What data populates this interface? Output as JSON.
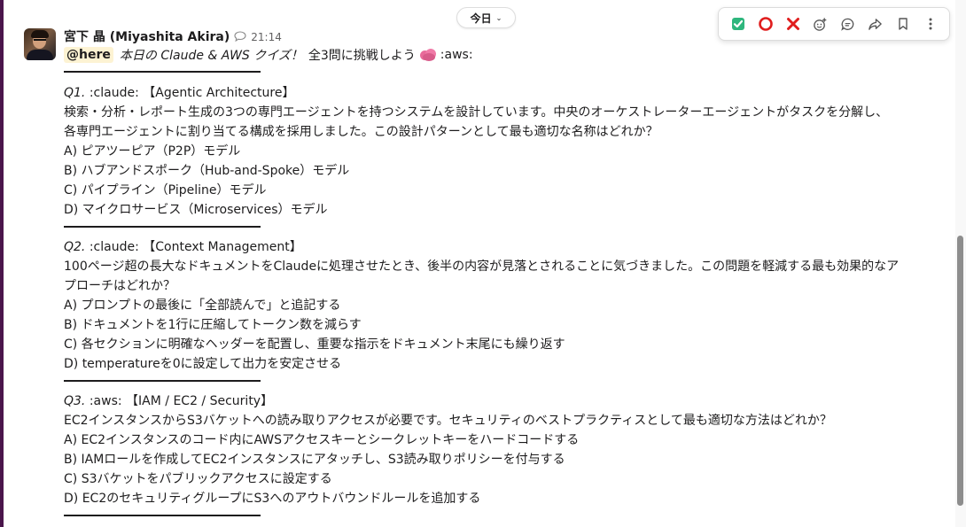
{
  "message": {
    "sender": "宮下 晶 (Miyashita Akira)",
    "time": "21:14",
    "date_divider": "今日",
    "intro": {
      "mention": "@here",
      "italic": "本日の Claude & AWS クイズ！",
      "rest": "全3問に挑戦しよう",
      "emoji_text": ":aws:"
    }
  },
  "toolbar": {
    "icons": [
      "check-icon",
      "circle-icon",
      "x-icon",
      "add-reaction-icon",
      "reply-thread-icon",
      "share-icon",
      "bookmark-icon",
      "more-icon"
    ]
  },
  "questions": [
    {
      "num": "Q1.",
      "tag": ":claude: 【Agentic Architecture】",
      "body_lines": [
        "検索・分析・レポート生成の3つの専門エージェントを持つシステムを設計しています。中央のオーケストレーターエージェントがタスクを分解し、",
        "各専門エージェントに割り当てる構成を採用しました。この設計パターンとして最も適切な名称はどれか？"
      ],
      "options": [
        "A) ピアツーピア（P2P）モデル",
        "B) ハブアンドスポーク（Hub-and-Spoke）モデル",
        "C) パイプライン（Pipeline）モデル",
        "D) マイクロサービス（Microservices）モデル"
      ]
    },
    {
      "num": "Q2.",
      "tag": ":claude: 【Context Management】",
      "body_lines": [
        "100ページ超の長大なドキュメントをClaudeに処理させたとき、後半の内容が見落とされることに気づきました。この問題を軽減する最も効果的なア",
        "プローチはどれか？"
      ],
      "options": [
        "A) プロンプトの最後に「全部読んで」と追記する",
        "B) ドキュメントを1行に圧縮してトークン数を減らす",
        "C) 各セクションに明確なヘッダーを配置し、重要な指示をドキュメント末尾にも繰り返す",
        "D) temperatureを0に設定して出力を安定させる"
      ]
    },
    {
      "num": "Q3.",
      "tag": ":aws: 【IAM / EC2 / Security】",
      "body_lines": [
        "EC2インスタンスからS3バケットへの読み取りアクセスが必要です。セキュリティのベストプラクティスとして最も適切な方法はどれか？"
      ],
      "options": [
        "A) EC2インスタンスのコード内にAWSアクセスキーとシークレットキーをハードコードする",
        "B) IAMロールを作成してEC2インスタンスにアタッチし、S3読み取りポリシーを付与する",
        "C) S3バケットをパブリックアクセスに設定する",
        "D) EC2のセキュリティグループにS3へのアウトバウンドルールを追加する"
      ]
    }
  ],
  "colors": {
    "check": "#2eb67d",
    "circle": "#e01e1e",
    "x": "#e01e1e",
    "mention_bg": "#fdf3d3",
    "rail": "#4a154b"
  }
}
